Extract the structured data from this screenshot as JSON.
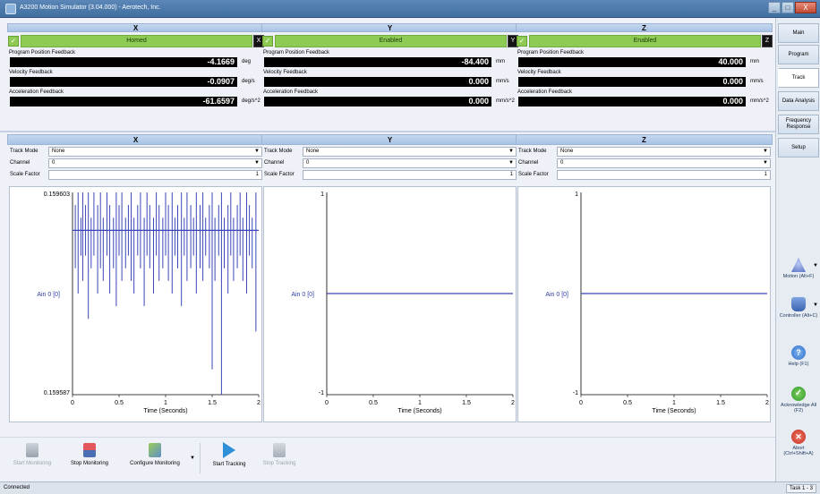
{
  "window": {
    "title": "A3200 Motion Simulator (3.04.000) - Aerotech, Inc.",
    "min": "_",
    "max": "□",
    "close": "X"
  },
  "axes": [
    {
      "name": "X",
      "enable_text": "Homed",
      "enable_btn": "X",
      "pos_label": "Program Position Feedback",
      "pos_value": "-4.1669",
      "pos_unit": "deg",
      "vel_label": "Velocity Feedback",
      "vel_value": "-0.0907",
      "vel_unit": "deg/s",
      "acc_label": "Acceleration Feedback",
      "acc_value": "-61.6597",
      "acc_unit": "deg/s^2"
    },
    {
      "name": "Y",
      "enable_text": "Enabled",
      "enable_btn": "Y",
      "pos_label": "Program Position Feedback",
      "pos_value": "-84.400",
      "pos_unit": "mm",
      "vel_label": "Velocity Feedback",
      "vel_value": "0.000",
      "vel_unit": "mm/s",
      "acc_label": "Acceleration Feedback",
      "acc_value": "0.000",
      "acc_unit": "mm/s^2"
    },
    {
      "name": "Z",
      "enable_text": "Enabled",
      "enable_btn": "Z",
      "pos_label": "Program Position Feedback",
      "pos_value": "40.000",
      "pos_unit": "mm",
      "vel_label": "Velocity Feedback",
      "vel_value": "0.000",
      "vel_unit": "mm/s",
      "acc_label": "Acceleration Feedback",
      "acc_value": "0.000",
      "acc_unit": "mm/s^2"
    }
  ],
  "plots": [
    {
      "name": "X",
      "track_mode_label": "Track Mode",
      "track_mode": "None",
      "channel_label": "Channel",
      "channel": "0",
      "scale_label": "Scale Factor",
      "scale": "1"
    },
    {
      "name": "Y",
      "track_mode_label": "Track Mode",
      "track_mode": "None",
      "channel_label": "Channel",
      "channel": "0",
      "scale_label": "Scale Factor",
      "scale": "1"
    },
    {
      "name": "Z",
      "track_mode_label": "Track Mode",
      "track_mode": "None",
      "channel_label": "Channel",
      "channel": "0",
      "scale_label": "Scale Factor",
      "scale": "1"
    }
  ],
  "chart_data": [
    {
      "type": "line",
      "ylabel": "Ain 0 [0]",
      "xlabel": "Time (Seconds)",
      "ylim": [
        0.159587,
        0.159603
      ],
      "y_tick_labels": [
        "0.159603",
        "0.159587"
      ],
      "xlim": [
        0,
        2
      ],
      "x_ticks": [
        "0",
        "0.5",
        "1",
        "1.5",
        "2"
      ],
      "baseline": 0.1596,
      "series": [
        {
          "x": [
            0.03,
            0.06,
            0.09,
            0.11,
            0.14,
            0.17,
            0.2,
            0.23,
            0.27,
            0.3,
            0.33,
            0.37,
            0.4,
            0.44,
            0.47,
            0.5,
            0.53,
            0.57,
            0.6,
            0.63,
            0.66,
            0.7,
            0.73,
            0.77,
            0.8,
            0.83,
            0.87,
            0.9,
            0.93,
            0.97,
            1.0,
            1.03,
            1.07,
            1.1,
            1.13,
            1.17,
            1.2,
            1.23,
            1.27,
            1.3,
            1.33,
            1.37,
            1.4,
            1.43,
            1.47,
            1.5,
            1.53,
            1.57,
            1.6,
            1.63,
            1.67,
            1.7,
            1.73,
            1.77,
            1.8,
            1.83,
            1.87,
            1.9,
            1.93,
            1.97
          ],
          "lo": [
            0.159597,
            0.159595,
            0.159598,
            0.159596,
            0.159598,
            0.159593,
            0.159597,
            0.159598,
            0.159595,
            0.159597,
            0.159596,
            0.159598,
            0.159595,
            0.159597,
            0.159594,
            0.159598,
            0.159596,
            0.159597,
            0.159598,
            0.159596,
            0.159595,
            0.159598,
            0.159597,
            0.159594,
            0.159598,
            0.159597,
            0.159595,
            0.159598,
            0.159596,
            0.159597,
            0.159598,
            0.159596,
            0.159595,
            0.159598,
            0.159597,
            0.159594,
            0.159598,
            0.159596,
            0.159597,
            0.159598,
            0.159595,
            0.159597,
            0.159596,
            0.159598,
            0.159597,
            0.159589,
            0.159596,
            0.159598,
            0.159587,
            0.159597,
            0.159595,
            0.159598,
            0.159596,
            0.159597,
            0.159598,
            0.159596,
            0.159595,
            0.159598,
            0.159597,
            0.159592
          ],
          "hi": [
            0.159602,
            0.159603,
            0.159601,
            0.159603,
            0.159602,
            0.159603,
            0.159601,
            0.159603,
            0.159602,
            0.159603,
            0.159601,
            0.159603,
            0.159602,
            0.159601,
            0.159603,
            0.159602,
            0.159603,
            0.159601,
            0.159602,
            0.159603,
            0.159601,
            0.159602,
            0.159603,
            0.159601,
            0.159603,
            0.159602,
            0.159601,
            0.159603,
            0.159602,
            0.159601,
            0.159603,
            0.159602,
            0.159603,
            0.159601,
            0.159602,
            0.159603,
            0.159601,
            0.159603,
            0.159602,
            0.159601,
            0.159603,
            0.159602,
            0.159603,
            0.159601,
            0.159602,
            0.159603,
            0.159601,
            0.159602,
            0.159603,
            0.159601,
            0.159602,
            0.159603,
            0.159601,
            0.159602,
            0.159603,
            0.159601,
            0.159603,
            0.159602,
            0.159601,
            0.159603
          ]
        }
      ]
    },
    {
      "type": "line",
      "ylabel": "Ain 0 [0]",
      "xlabel": "Time (Seconds)",
      "ylim": [
        -1,
        1
      ],
      "y_tick_labels": [
        "1",
        "-1"
      ],
      "xlim": [
        0,
        2
      ],
      "x_ticks": [
        "0",
        "0.5",
        "1",
        "1.5",
        "2"
      ],
      "series": [
        {
          "x": [
            0,
            2
          ],
          "y": [
            0,
            0
          ]
        }
      ]
    },
    {
      "type": "line",
      "ylabel": "Ain 0 [0]",
      "xlabel": "Time (Seconds)",
      "ylim": [
        -1,
        1
      ],
      "y_tick_labels": [
        "1",
        "-1"
      ],
      "xlim": [
        0,
        2
      ],
      "x_ticks": [
        "0",
        "0.5",
        "1",
        "1.5",
        "2"
      ],
      "series": [
        {
          "x": [
            0,
            2
          ],
          "y": [
            0,
            0
          ]
        }
      ]
    }
  ],
  "toolbar": {
    "start_monitoring": "Start Monitoring",
    "stop_monitoring": "Stop Monitoring",
    "configure_monitoring": "Configure Monitoring",
    "start_tracking": "Start Tracking",
    "stop_tracking": "Stop Tracking"
  },
  "right_tabs": [
    "Main",
    "Program",
    "Track",
    "Data Analysis",
    "Frequency Response",
    "Setup"
  ],
  "right_buttons": {
    "motion": "Motion (Alt+F)",
    "controller": "Controller (Alt+C)",
    "help": "Help (F1)",
    "acknowledge": "Acknowledge All (F2)",
    "abort": "Abort (Ctrl+Shift+A)"
  },
  "status": {
    "text": "Connected",
    "task": "Task 1 - 3"
  },
  "colors": {
    "enabled": "#8dcb55",
    "trace": "#3a46b8",
    "header": "#b7cce9"
  }
}
